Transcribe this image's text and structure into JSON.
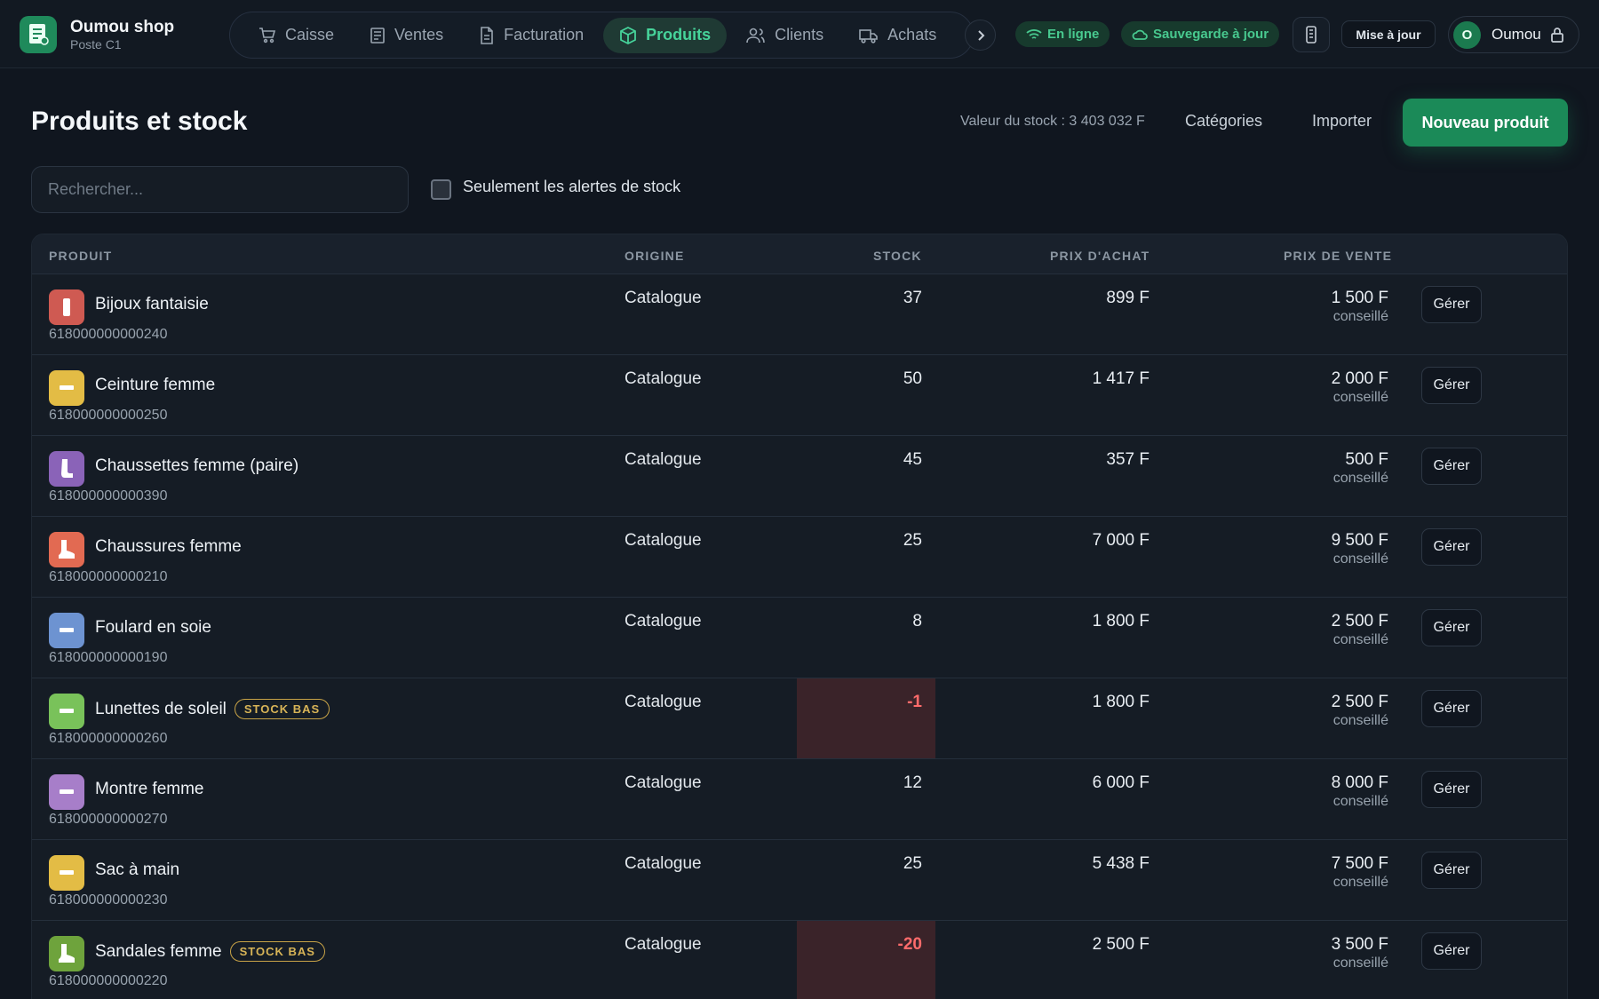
{
  "app": {
    "shop_name": "Oumou shop",
    "station": "Poste C1"
  },
  "nav": {
    "items": [
      {
        "label": "Caisse",
        "icon": "cart-icon"
      },
      {
        "label": "Ventes",
        "icon": "receipt-icon"
      },
      {
        "label": "Facturation",
        "icon": "document-icon"
      },
      {
        "label": "Produits",
        "icon": "box-icon",
        "active": true
      },
      {
        "label": "Clients",
        "icon": "users-icon"
      },
      {
        "label": "Achats",
        "icon": "truck-icon"
      }
    ]
  },
  "status": {
    "online": "En ligne",
    "backup": "Sauvegarde à jour",
    "update_label": "Mise à jour",
    "user_initial": "O",
    "user_name": "Oumou"
  },
  "page": {
    "title": "Produits et stock",
    "stock_value": "Valeur du stock : 3 403 032 F",
    "categories_label": "Catégories",
    "import_label": "Importer",
    "new_product_label": "Nouveau produit",
    "search_placeholder": "Rechercher...",
    "alerts_only_label": "Seulement les alertes de stock"
  },
  "table": {
    "headers": {
      "product": "PRODUIT",
      "origin": "ORIGINE",
      "stock": "STOCK",
      "buy_price": "PRIX D'ACHAT",
      "sell_price": "PRIX DE VENTE"
    },
    "manage_label": "Gérer",
    "sell_note": "conseillé",
    "low_stock_badge": "STOCK BAS",
    "rows": [
      {
        "name": "Bijoux fantaisie",
        "code": "618000000000240",
        "origin": "Catalogue",
        "stock": "37",
        "buy": "899 F",
        "sell": "1 500 F",
        "color": "#cf5a52",
        "glyph": "bar",
        "low": false
      },
      {
        "name": "Ceinture femme",
        "code": "618000000000250",
        "origin": "Catalogue",
        "stock": "50",
        "buy": "1 417 F",
        "sell": "2 000 F",
        "color": "#e3bc45",
        "glyph": "dash",
        "low": false
      },
      {
        "name": "Chaussettes femme (paire)",
        "code": "618000000000390",
        "origin": "Catalogue",
        "stock": "45",
        "buy": "357 F",
        "sell": "500 F",
        "color": "#8a63b8",
        "glyph": "sock",
        "low": false
      },
      {
        "name": "Chaussures femme",
        "code": "618000000000210",
        "origin": "Catalogue",
        "stock": "25",
        "buy": "7 000 F",
        "sell": "9 500 F",
        "color": "#e26a52",
        "glyph": "boot",
        "low": false
      },
      {
        "name": "Foulard en soie",
        "code": "618000000000190",
        "origin": "Catalogue",
        "stock": "8",
        "buy": "1 800 F",
        "sell": "2 500 F",
        "color": "#6d93d1",
        "glyph": "dash",
        "low": false
      },
      {
        "name": "Lunettes de soleil",
        "code": "618000000000260",
        "origin": "Catalogue",
        "stock": "-1",
        "buy": "1 800 F",
        "sell": "2 500 F",
        "color": "#79c25a",
        "glyph": "dash",
        "low": true
      },
      {
        "name": "Montre femme",
        "code": "618000000000270",
        "origin": "Catalogue",
        "stock": "12",
        "buy": "6 000 F",
        "sell": "8 000 F",
        "color": "#a77ec9",
        "glyph": "dash",
        "low": false
      },
      {
        "name": "Sac à main",
        "code": "618000000000230",
        "origin": "Catalogue",
        "stock": "25",
        "buy": "5 438 F",
        "sell": "7 500 F",
        "color": "#e3bc45",
        "glyph": "dash",
        "low": false
      },
      {
        "name": "Sandales femme",
        "code": "618000000000220",
        "origin": "Catalogue",
        "stock": "-20",
        "buy": "2 500 F",
        "sell": "3 500 F",
        "color": "#6ea33c",
        "glyph": "boot",
        "low": true
      }
    ]
  },
  "colors": {
    "accent": "#1b8a58",
    "active_nav": "#46d39a",
    "low_stock_bg": "#3a2329",
    "low_stock_text": "#ff6b6b",
    "badge": "#d8b457"
  }
}
